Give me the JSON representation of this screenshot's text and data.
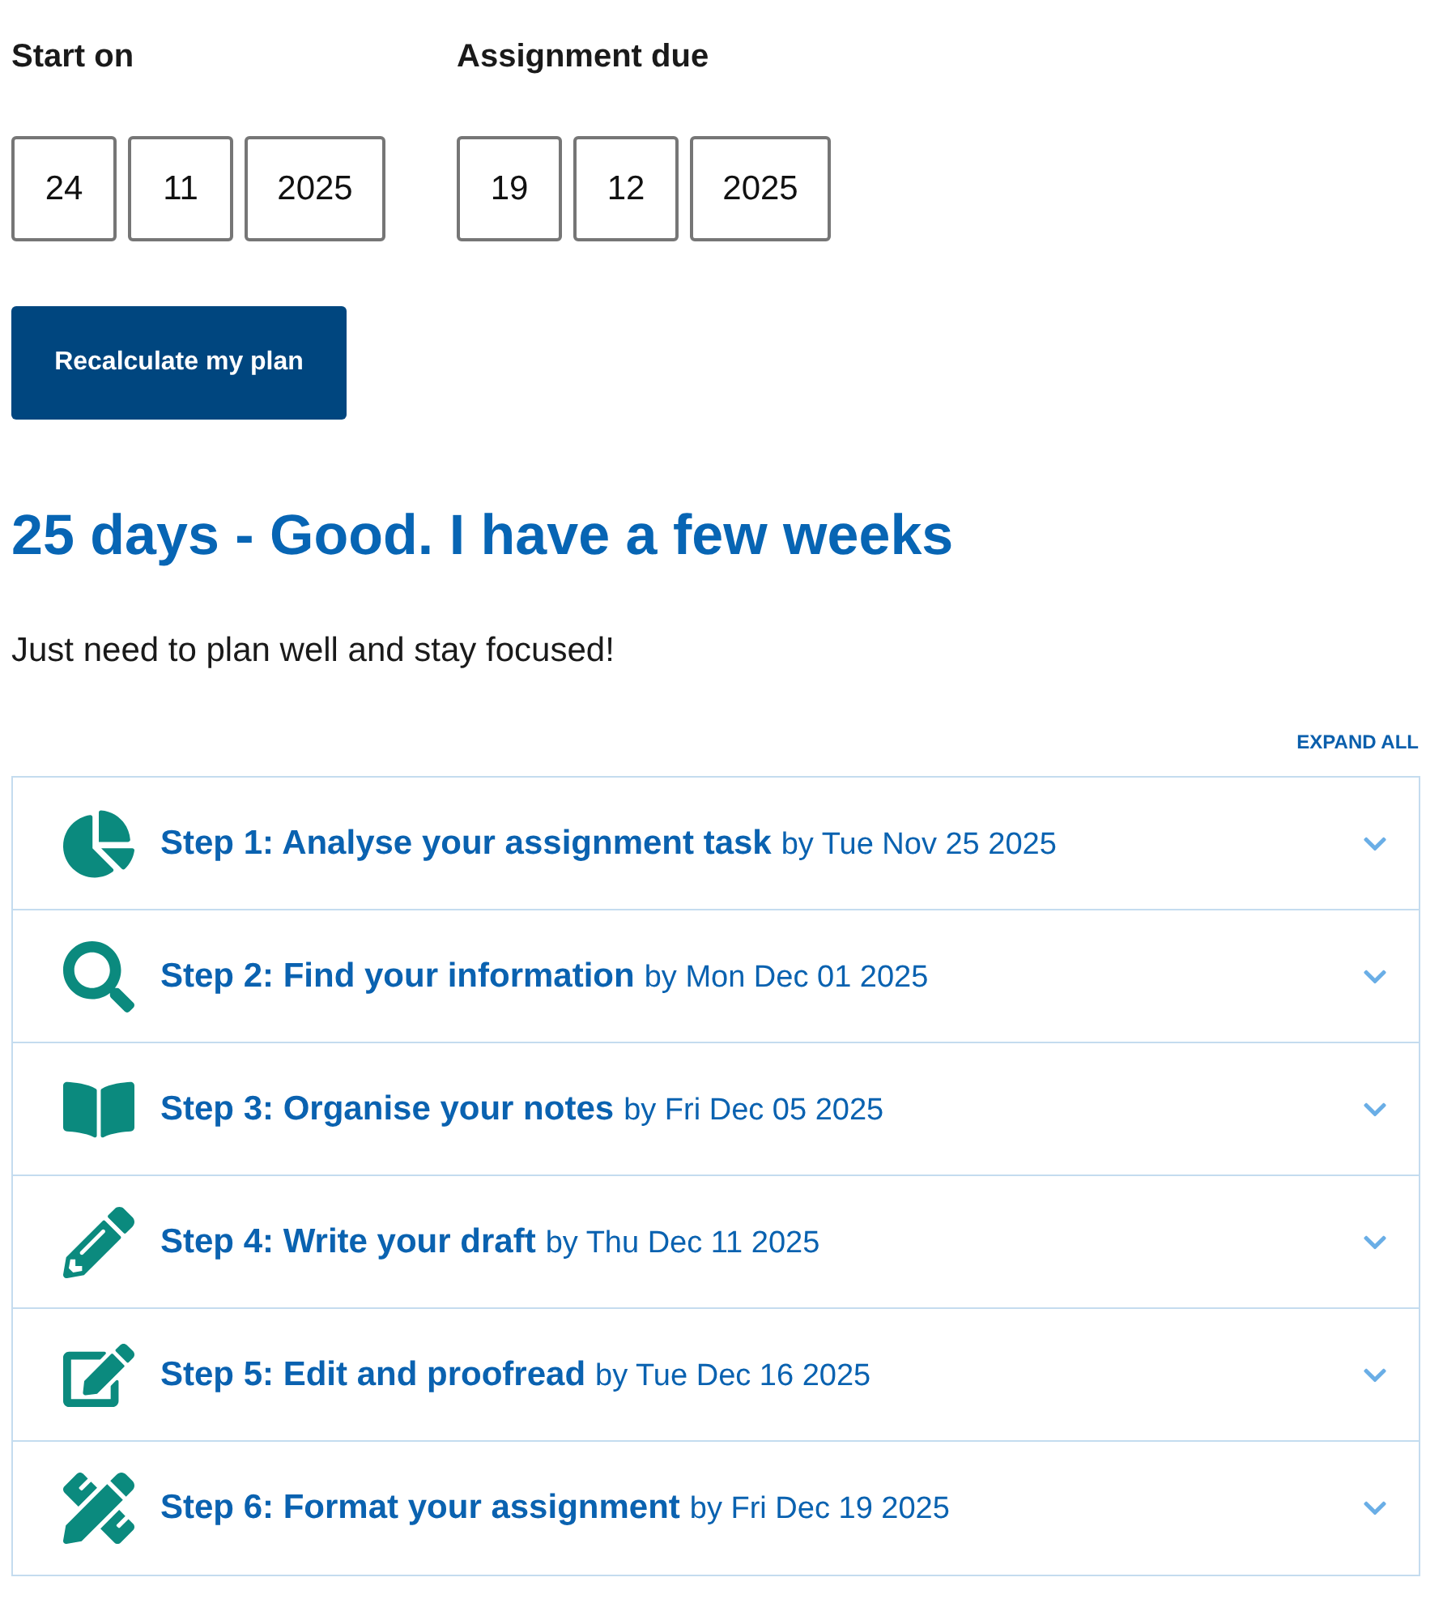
{
  "date_groups": [
    {
      "label": "Start on",
      "fields": [
        "24",
        "11",
        "2025"
      ]
    },
    {
      "label": "Assignment due",
      "fields": [
        "19",
        "12",
        "2025"
      ]
    }
  ],
  "recalculate_button": "Recalculate my plan",
  "result": {
    "heading": "25 days - Good. I have a few weeks",
    "message": "Just need to plan well and stay focused!"
  },
  "expand_all": "EXPAND ALL",
  "steps": [
    {
      "title": "Step 1: Analyse your assignment task",
      "due": "by Tue Nov 25 2025",
      "expanded": false
    },
    {
      "title": "Step 2: Find your information",
      "due": "by Mon Dec 01 2025",
      "expanded": false
    },
    {
      "title": "Step 3: Organise your notes",
      "due": "by Fri Dec 05 2025",
      "expanded": false
    },
    {
      "title": "Step 4: Write your draft",
      "due": "by Thu Dec 11 2025",
      "expanded": false
    },
    {
      "title": "Step 5: Edit and proofread",
      "due": "by Tue Dec 16 2025",
      "expanded": false
    },
    {
      "title": "Step 6: Format your assignment",
      "due": "by Fri Dec 19 2025",
      "expanded": false
    }
  ]
}
